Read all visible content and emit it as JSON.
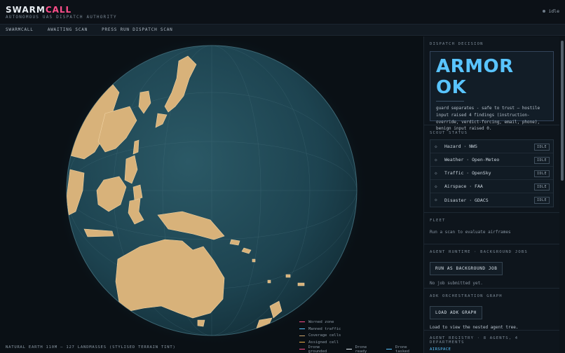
{
  "header": {
    "brand_a": "SWARM",
    "brand_b": "CALL",
    "subtitle": "AUTONOMOUS UAS DISPATCH AUTHORITY",
    "status": "idle"
  },
  "nav": {
    "items": [
      "SWARMCALL",
      "AWAITING SCAN",
      "PRESS RUN DISPATCH SCAN"
    ]
  },
  "map": {
    "caption": "NATURAL EARTH 110M — 127 LANDMASSES (STYLISED TERRAIN TINT)",
    "legend": [
      {
        "label": "Worned zone",
        "color": "#ff4f8b"
      },
      {
        "label": "Manned traffic",
        "color": "#59c4ff"
      },
      {
        "label": "Coverage cells",
        "color": "#c9a36a"
      },
      {
        "label": "Assigned cell",
        "color": "#f0b24a"
      }
    ],
    "legend_inline": [
      {
        "label": "Drone grounded",
        "color": "#ff4f8b"
      },
      {
        "label": "Drone ready",
        "color": "#e6eef5"
      },
      {
        "label": "Drone tasked",
        "color": "#59c4ff"
      }
    ]
  },
  "panel": {
    "decision": {
      "title": "DISPATCH DECISION",
      "verdict": "ARMOR OK",
      "text": "guard separates - safe to trust — hostile input raised 4 findings (instruction-override, verdict-forcing, email, phone), benign input raised 0."
    },
    "scouts": {
      "title": "SCOUT STATUS",
      "items": [
        {
          "name": "Hazard · NWS",
          "badge": "IDLE"
        },
        {
          "name": "Weather · Open-Meteo",
          "badge": "IDLE"
        },
        {
          "name": "Traffic · OpenSky",
          "badge": "IDLE"
        },
        {
          "name": "Airspace · FAA",
          "badge": "IDLE"
        },
        {
          "name": "Disaster · GDACS",
          "badge": "IDLE"
        }
      ]
    },
    "fleet": {
      "title": "FLEET",
      "text": "Run a scan to evaluate airframes"
    },
    "runtime": {
      "title": "AGENT RUNTIME · BACKGROUND JOBS",
      "button": "RUN AS BACKGROUND JOB",
      "text": "No job submitted yet."
    },
    "graph": {
      "title": "ADK ORCHESTRATION GRAPH",
      "button": "LOAD ADK GRAPH",
      "text": "Load to view the nested agent tree."
    },
    "registry": {
      "title": "AGENT REGISTRY · 8 AGENTS, 4 DEPARTMENTS",
      "link": "AIRSPACE"
    }
  }
}
